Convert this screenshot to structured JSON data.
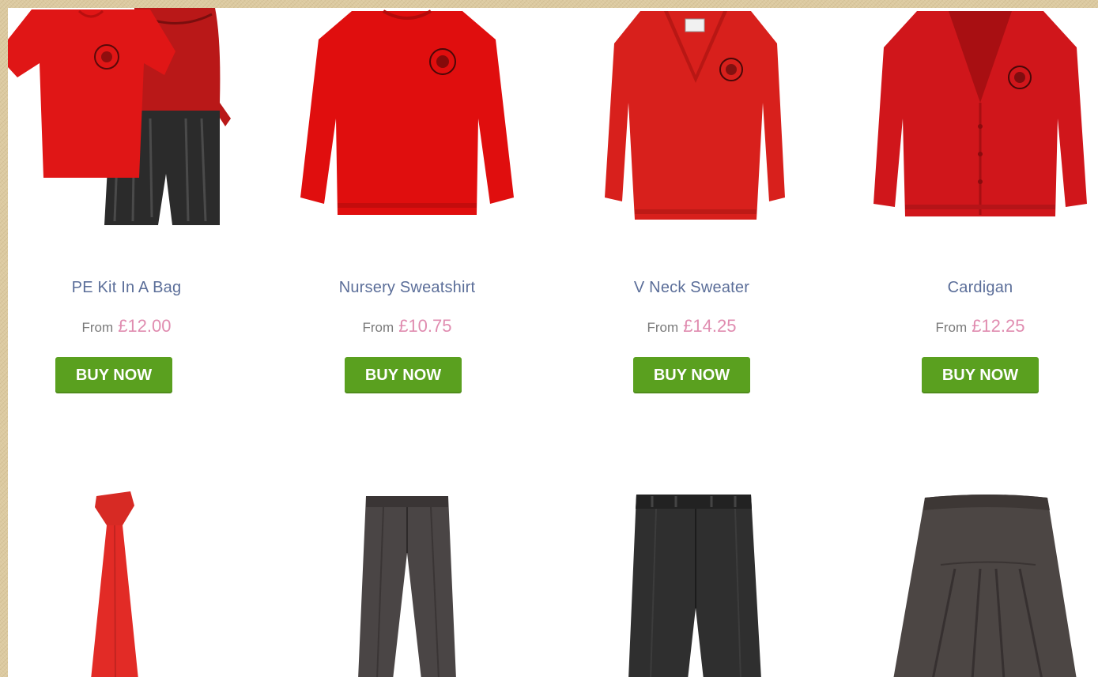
{
  "products": [
    {
      "name": "PE Kit In A Bag",
      "from_label": "From",
      "price": "£12.00",
      "button": "BUY NOW",
      "icon": "pe-kit-image"
    },
    {
      "name": "Nursery Sweatshirt",
      "from_label": "From",
      "price": "£10.75",
      "button": "BUY NOW",
      "icon": "sweatshirt-image"
    },
    {
      "name": "V Neck Sweater",
      "from_label": "From",
      "price": "£14.25",
      "button": "BUY NOW",
      "icon": "v-neck-sweater-image"
    },
    {
      "name": "Cardigan",
      "from_label": "From",
      "price": "£12.25",
      "button": "BUY NOW",
      "icon": "cardigan-image"
    }
  ],
  "row2": [
    {
      "icon": "tie-image"
    },
    {
      "icon": "trousers-image"
    },
    {
      "icon": "shorts-image"
    },
    {
      "icon": "skirt-image"
    }
  ],
  "colors": {
    "uniform_red": "#d81c1c",
    "grey": "#3a3a3a",
    "button_green": "#5aa01f",
    "name_blue": "#5b6e99",
    "price_pink": "#e08cb0"
  }
}
